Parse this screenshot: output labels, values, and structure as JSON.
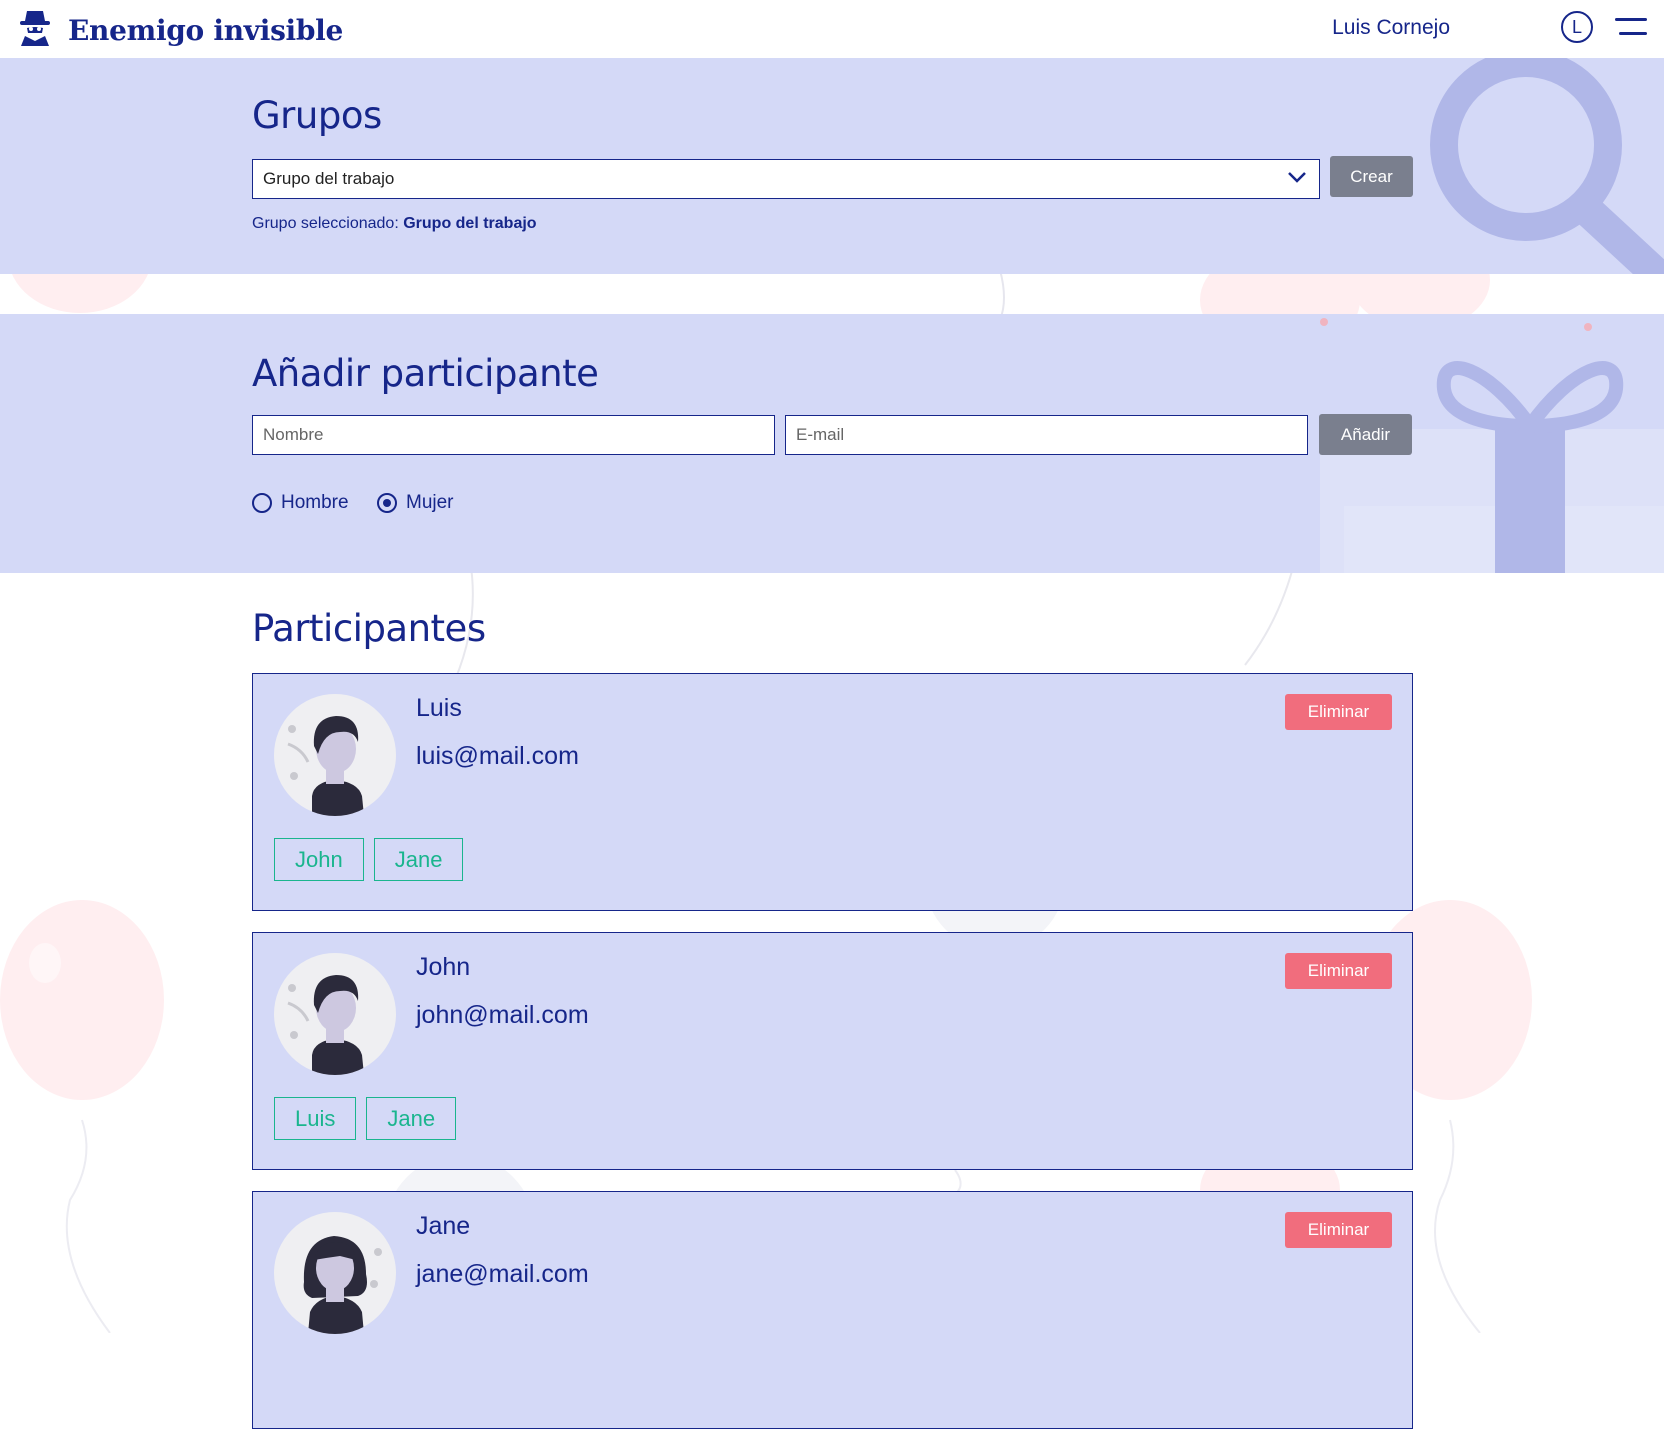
{
  "header": {
    "brand": "Enemigo invisible",
    "user_name": "Luis Cornejo",
    "user_initial": "L"
  },
  "groups": {
    "title": "Grupos",
    "selected_value": "Grupo del trabajo",
    "create_label": "Crear",
    "selected_prefix": "Grupo seleccionado:",
    "selected_name": "Grupo del trabajo"
  },
  "add_participant": {
    "title": "Añadir participante",
    "name_placeholder": "Nombre",
    "email_placeholder": "E-mail",
    "add_label": "Añadir",
    "gender_options": [
      {
        "label": "Hombre",
        "selected": false
      },
      {
        "label": "Mujer",
        "selected": true
      }
    ]
  },
  "participants": {
    "title": "Participantes",
    "delete_label": "Eliminar",
    "items": [
      {
        "name": "Luis",
        "email": "luis@mail.com",
        "avatar": "male-avatar",
        "exclusions": [
          "John",
          "Jane"
        ]
      },
      {
        "name": "John",
        "email": "john@mail.com",
        "avatar": "male-avatar",
        "exclusions": [
          "Luis",
          "Jane"
        ]
      },
      {
        "name": "Jane",
        "email": "jane@mail.com",
        "avatar": "female-avatar",
        "exclusions": []
      }
    ]
  },
  "colors": {
    "primary": "#16268a",
    "band_bg": "#d4d9f7",
    "danger": "#f16d7d",
    "success": "#1ab58e",
    "neutral_button": "#7a7f8e"
  }
}
